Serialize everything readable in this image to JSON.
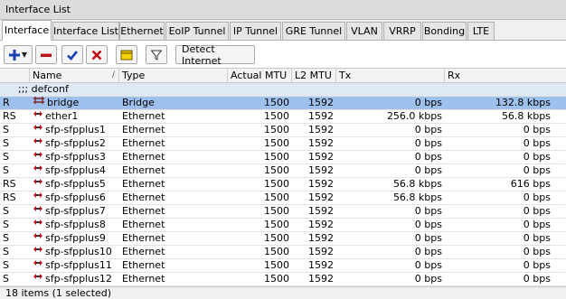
{
  "window": {
    "title": "Interface List"
  },
  "tabs": [
    {
      "label": "Interface",
      "active": true
    },
    {
      "label": "Interface List"
    },
    {
      "label": "Ethernet"
    },
    {
      "label": "EoIP Tunnel"
    },
    {
      "label": "IP Tunnel"
    },
    {
      "label": "GRE Tunnel"
    },
    {
      "label": "VLAN"
    },
    {
      "label": "VRRP"
    },
    {
      "label": "Bonding"
    },
    {
      "label": "LTE"
    }
  ],
  "toolbar": {
    "add_icon": "plus-icon",
    "remove_icon": "minus-icon",
    "enable_icon": "checkmark-icon",
    "disable_icon": "x-icon",
    "comment_icon": "note-icon",
    "filter_icon": "filter-icon",
    "detect_label": "Detect Internet",
    "colors": {
      "add": "#1a3fb0",
      "remove": "#c0101a",
      "enable": "#1a3fb0",
      "disable": "#c0101a",
      "comment": "#f5d300"
    }
  },
  "table": {
    "headers": [
      "",
      "Name",
      "Type",
      "Actual MTU",
      "L2 MTU",
      "Tx",
      "Rx"
    ],
    "sort_indicator": "/",
    "group_label": ";;; defconf",
    "rows": [
      {
        "flag": "R",
        "name": "bridge",
        "icon": "bridge-icon",
        "type": "Bridge",
        "mtu": "1500",
        "l2mtu": "1592",
        "tx": "0 bps",
        "rx": "132.8 kbps",
        "selected": true
      },
      {
        "flag": "RS",
        "name": "ether1",
        "icon": "ethernet-icon",
        "type": "Ethernet",
        "mtu": "1500",
        "l2mtu": "1592",
        "tx": "256.0 kbps",
        "rx": "56.8 kbps"
      },
      {
        "flag": "S",
        "name": "sfp-sfpplus1",
        "icon": "ethernet-icon",
        "type": "Ethernet",
        "mtu": "1500",
        "l2mtu": "1592",
        "tx": "0 bps",
        "rx": "0 bps"
      },
      {
        "flag": "S",
        "name": "sfp-sfpplus2",
        "icon": "ethernet-icon",
        "type": "Ethernet",
        "mtu": "1500",
        "l2mtu": "1592",
        "tx": "0 bps",
        "rx": "0 bps"
      },
      {
        "flag": "S",
        "name": "sfp-sfpplus3",
        "icon": "ethernet-icon",
        "type": "Ethernet",
        "mtu": "1500",
        "l2mtu": "1592",
        "tx": "0 bps",
        "rx": "0 bps"
      },
      {
        "flag": "S",
        "name": "sfp-sfpplus4",
        "icon": "ethernet-icon",
        "type": "Ethernet",
        "mtu": "1500",
        "l2mtu": "1592",
        "tx": "0 bps",
        "rx": "0 bps"
      },
      {
        "flag": "RS",
        "name": "sfp-sfpplus5",
        "icon": "ethernet-icon",
        "type": "Ethernet",
        "mtu": "1500",
        "l2mtu": "1592",
        "tx": "56.8 kbps",
        "rx": "616 bps"
      },
      {
        "flag": "RS",
        "name": "sfp-sfpplus6",
        "icon": "ethernet-icon",
        "type": "Ethernet",
        "mtu": "1500",
        "l2mtu": "1592",
        "tx": "56.8 kbps",
        "rx": "0 bps"
      },
      {
        "flag": "S",
        "name": "sfp-sfpplus7",
        "icon": "ethernet-icon",
        "type": "Ethernet",
        "mtu": "1500",
        "l2mtu": "1592",
        "tx": "0 bps",
        "rx": "0 bps"
      },
      {
        "flag": "S",
        "name": "sfp-sfpplus8",
        "icon": "ethernet-icon",
        "type": "Ethernet",
        "mtu": "1500",
        "l2mtu": "1592",
        "tx": "0 bps",
        "rx": "0 bps"
      },
      {
        "flag": "S",
        "name": "sfp-sfpplus9",
        "icon": "ethernet-icon",
        "type": "Ethernet",
        "mtu": "1500",
        "l2mtu": "1592",
        "tx": "0 bps",
        "rx": "0 bps"
      },
      {
        "flag": "S",
        "name": "sfp-sfpplus10",
        "icon": "ethernet-icon",
        "type": "Ethernet",
        "mtu": "1500",
        "l2mtu": "1592",
        "tx": "0 bps",
        "rx": "0 bps"
      },
      {
        "flag": "S",
        "name": "sfp-sfpplus11",
        "icon": "ethernet-icon",
        "type": "Ethernet",
        "mtu": "1500",
        "l2mtu": "1592",
        "tx": "0 bps",
        "rx": "0 bps"
      },
      {
        "flag": "S",
        "name": "sfp-sfpplus12",
        "icon": "ethernet-icon",
        "type": "Ethernet",
        "mtu": "1500",
        "l2mtu": "1592",
        "tx": "0 bps",
        "rx": "0 bps"
      }
    ]
  },
  "status": {
    "text": "18 items (1 selected)"
  },
  "colors": {
    "selected_row": "#9ec0ec",
    "group_row": "#dfe8f5"
  }
}
